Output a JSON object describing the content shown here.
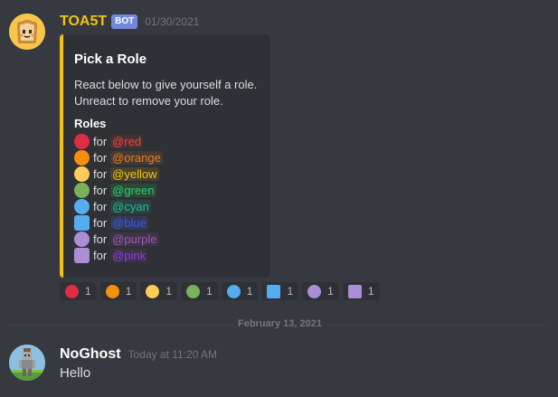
{
  "messages": [
    {
      "author": "TOA5T",
      "bot_tag": "BOT",
      "timestamp": "01/30/2021",
      "embed": {
        "color": "#f1c40f",
        "title": "Pick a Role",
        "description_line1": "React below to give yourself a role.",
        "description_line2": "Unreact to remove your role.",
        "field_name": "Roles",
        "roles": [
          {
            "emoji": "red-circle",
            "shape": "circle",
            "emoji_color": "#dd2e44",
            "for": "for",
            "mention": "@red",
            "mention_color": "#e74c3c",
            "mention_bg": "#4a3034"
          },
          {
            "emoji": "orange-circle",
            "shape": "circle",
            "emoji_color": "#f4900c",
            "for": "for",
            "mention": "@orange",
            "mention_color": "#e67e22",
            "mention_bg": "#473a30"
          },
          {
            "emoji": "yellow-circle",
            "shape": "circle",
            "emoji_color": "#fdcb58",
            "for": "for",
            "mention": "@yellow",
            "mention_color": "#f1c40f",
            "mention_bg": "#474330"
          },
          {
            "emoji": "green-circle",
            "shape": "circle",
            "emoji_color": "#78b159",
            "for": "for",
            "mention": "@green",
            "mention_color": "#2ecc71",
            "mention_bg": "#2f4737"
          },
          {
            "emoji": "blue-circle",
            "shape": "circle",
            "emoji_color": "#55acee",
            "for": "for",
            "mention": "@cyan",
            "mention_color": "#1abc9c",
            "mention_bg": "#2c443f"
          },
          {
            "emoji": "blue-square",
            "shape": "square",
            "emoji_color": "#55acee",
            "for": "for",
            "mention": "@blue",
            "mention_color": "#3858f0",
            "mention_bg": "#333a4f"
          },
          {
            "emoji": "purple-circle",
            "shape": "circle",
            "emoji_color": "#aa8ed6",
            "for": "for",
            "mention": "@purple",
            "mention_color": "#9b59b6",
            "mention_bg": "#3d3546"
          },
          {
            "emoji": "purple-square",
            "shape": "square",
            "emoji_color": "#aa8ed6",
            "for": "for",
            "mention": "@pink",
            "mention_color": "#8e3ce6",
            "mention_bg": "#3b3248"
          }
        ]
      },
      "reactions": [
        {
          "emoji": "red-circle",
          "shape": "circle",
          "color": "#dd2e44",
          "count": "1"
        },
        {
          "emoji": "orange-circle",
          "shape": "circle",
          "color": "#f4900c",
          "count": "1"
        },
        {
          "emoji": "yellow-circle",
          "shape": "circle",
          "color": "#fdcb58",
          "count": "1"
        },
        {
          "emoji": "green-circle",
          "shape": "circle",
          "color": "#78b159",
          "count": "1"
        },
        {
          "emoji": "blue-circle",
          "shape": "circle",
          "color": "#55acee",
          "count": "1"
        },
        {
          "emoji": "blue-square",
          "shape": "square",
          "color": "#55acee",
          "count": "1"
        },
        {
          "emoji": "purple-circle",
          "shape": "circle",
          "color": "#aa8ed6",
          "count": "1"
        },
        {
          "emoji": "purple-square",
          "shape": "square",
          "color": "#aa8ed6",
          "count": "1"
        }
      ]
    },
    {
      "author": "NoGhost",
      "timestamp": "Today at 11:20 AM",
      "content": "Hello"
    }
  ],
  "date_divider": "February 13, 2021"
}
